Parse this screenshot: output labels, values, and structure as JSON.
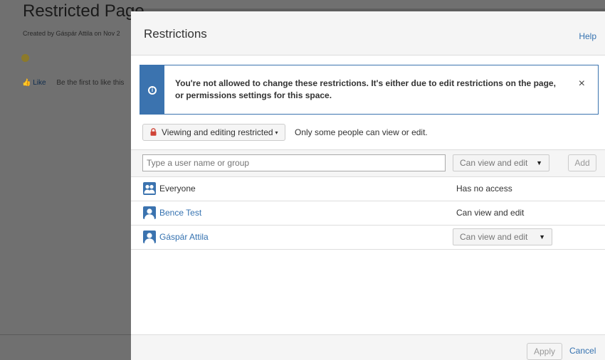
{
  "background_page": {
    "title": "Restricted Page",
    "meta": "Created by Gáspár Attila on Nov 2",
    "like_label": "Like",
    "like_prompt": "Be the first to like this"
  },
  "dialog": {
    "title": "Restrictions",
    "help_label": "Help",
    "alert": {
      "message": "You're not allowed to change these restrictions. It's either due to edit restrictions on the page, or permissions settings for this space.",
      "close_label": "×"
    },
    "restriction": {
      "button_label": "Viewing and editing restricted",
      "caret": "▾",
      "note": "Only some people can view or edit."
    },
    "add_user": {
      "placeholder": "Type a user name or group",
      "permission": "Can view and edit",
      "add_label": "Add"
    },
    "entries": [
      {
        "name": "Everyone",
        "permission": "Has no access",
        "icon": "group-icon"
      },
      {
        "name": "Bence Test",
        "permission": "Can view and edit",
        "icon": "user-icon"
      },
      {
        "name": "Gáspár Attila",
        "permission": "Can view and edit",
        "icon": "user-icon"
      }
    ],
    "select_caret": "▼",
    "footer": {
      "apply_label": "Apply",
      "cancel_label": "Cancel"
    }
  },
  "colors": {
    "accent": "#3b73af",
    "link": "#3572b0",
    "lock": "#d04437",
    "overlay": "#707070"
  }
}
